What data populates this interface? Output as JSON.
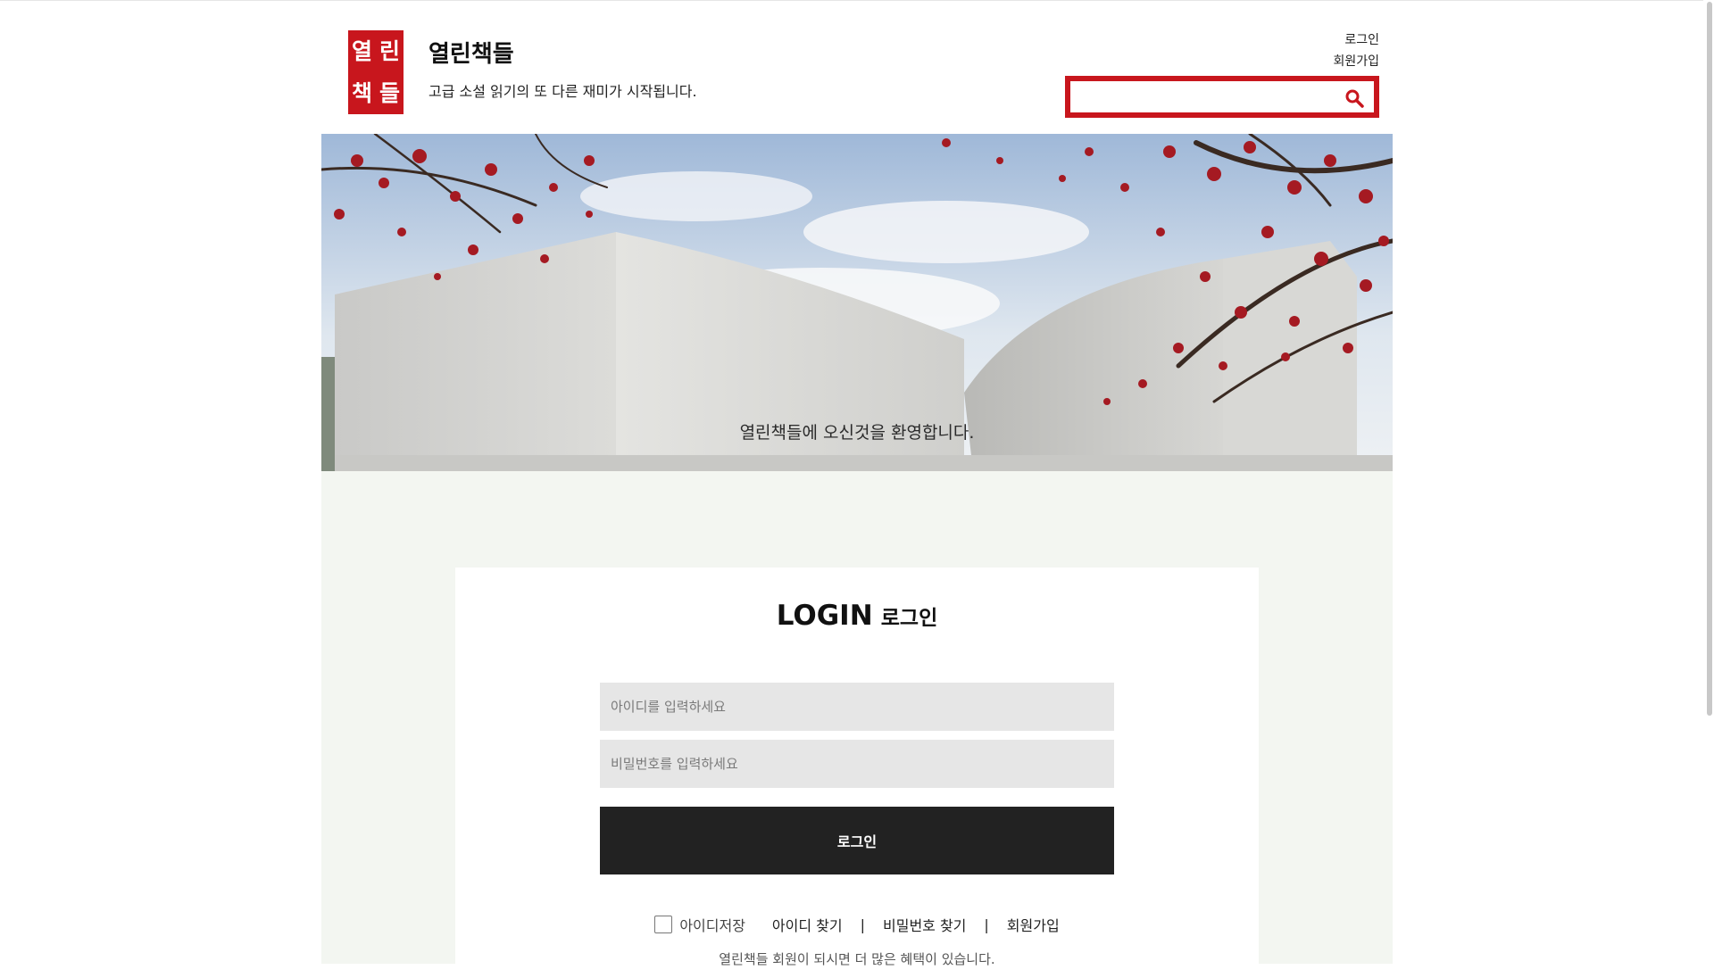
{
  "header": {
    "logo_glyphs": [
      "열",
      "린",
      "책",
      "들"
    ],
    "site_title": "열린책들",
    "tagline": "고급 소설 읽기의 또 다른 재미가 시작됩니다.",
    "login_link": "로그인",
    "join_link": "회원가입",
    "search_placeholder": "",
    "search_icon": "search-icon"
  },
  "hero": {
    "caption": "열린책들에 오신것을 환영합니다."
  },
  "login": {
    "heading_en": "LOGIN",
    "heading_ko": "로그인",
    "id_placeholder": "아이디를 입력하세요",
    "pw_placeholder": "비밀번호를 입력하세요",
    "submit_label": "로그인",
    "save_id_label": "아이디저장",
    "find_id_label": "아이디 찾기",
    "find_pw_label": "비밀번호 찾기",
    "join_label": "회원가입",
    "separator": "|",
    "benefit_text": "열린책들 회원이 되시면 더 많은 혜택이 있습니다."
  },
  "colors": {
    "brand_red": "#c8161d",
    "button_dark": "#222222",
    "field_bg": "#e6e6e6",
    "band_bg": "#f3f6f1"
  }
}
